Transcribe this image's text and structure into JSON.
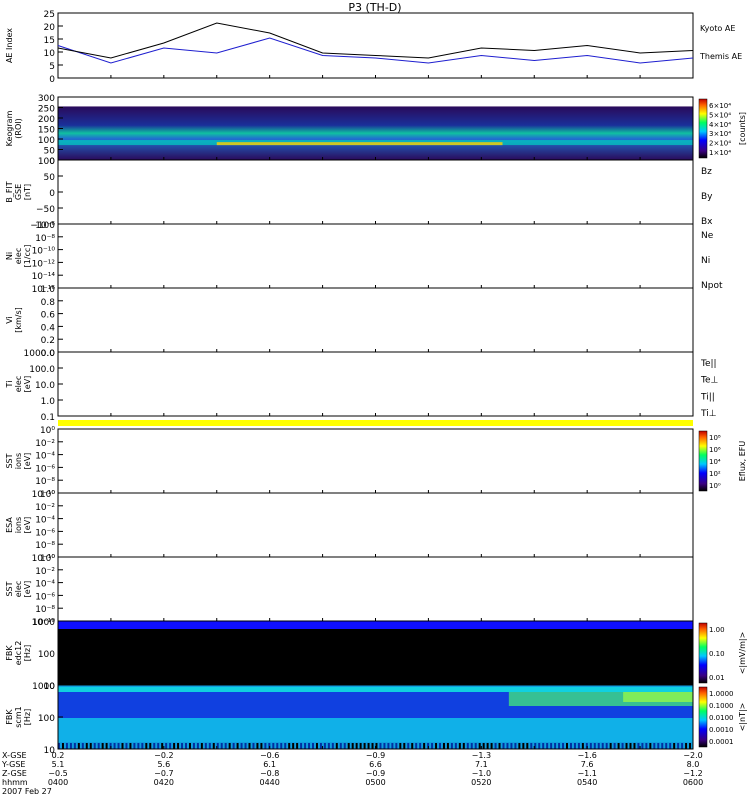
{
  "title": "P3 (TH-D)",
  "colors": {
    "black": "#000000",
    "blue": "#1e1ecf",
    "red": "#d00000",
    "green": "#00c000",
    "navy": "#0000a0",
    "yellow": "#ffff00",
    "fbk_blue": "#1010ff"
  },
  "chart_data": [
    {
      "panel": "ae",
      "type": "line",
      "ylabel": "AE Index",
      "yticks": [
        "25",
        "20",
        "15",
        "10",
        "5",
        "0"
      ],
      "ylim": [
        0,
        26
      ],
      "x": [
        "0400",
        "0410",
        "0420",
        "0430",
        "0440",
        "0450",
        "0500",
        "0510",
        "0520",
        "0530",
        "0540",
        "0550",
        "0600"
      ],
      "series": [
        {
          "name": "Kyoto AE",
          "color_key": "blue",
          "values": [
            13,
            6,
            12,
            10,
            16,
            9,
            8,
            6,
            9,
            7,
            9,
            6,
            8
          ]
        },
        {
          "name": "Themis AE",
          "color_key": "black",
          "values": [
            12,
            8,
            14,
            22,
            18,
            10,
            9,
            8,
            12,
            11,
            13,
            10,
            11
          ]
        }
      ]
    },
    {
      "panel": "keogram",
      "type": "heatmap",
      "ylabel": "Keogram",
      "ylabel2": "(ROI)",
      "yticks": [
        "300",
        "250",
        "200",
        "150",
        "100",
        "50",
        "0"
      ],
      "ylim": [
        0,
        300
      ],
      "colorbar_ticks": [
        "6×10⁴",
        "5×10⁴",
        "4×10⁴",
        "3×10⁴",
        "2×10⁴",
        "1×10⁴"
      ],
      "colorbar_label": "[counts]"
    },
    {
      "panel": "bfit",
      "type": "line",
      "ylabel": "B_FIT",
      "ylabel2": "GSE",
      "ylabel3": "[nT]",
      "yticks": [
        "100",
        "50",
        "0",
        "−50",
        "−100"
      ],
      "ylim": [
        -100,
        100
      ],
      "labels": [
        {
          "text": "Bz",
          "color_key": "red"
        },
        {
          "text": "By",
          "color_key": "green"
        },
        {
          "text": "Bx",
          "color_key": "navy"
        }
      ]
    },
    {
      "panel": "density",
      "type": "line",
      "ylabel": "Ni",
      "ylabel2": "elec",
      "ylabel3": "[1/cc]",
      "yticks": [
        "10⁻⁶",
        "10⁻⁸",
        "10⁻¹⁰",
        "10⁻¹²",
        "10⁻¹⁴",
        "10⁻¹⁶"
      ],
      "labels": [
        {
          "text": "Ne",
          "color_key": "red"
        },
        {
          "text": "Ni",
          "color_key": "black"
        },
        {
          "text": "Npot",
          "color_key": "navy"
        }
      ]
    },
    {
      "panel": "velocity",
      "type": "line",
      "ylabel": "Vi",
      "ylabel2": "[km/s]",
      "yticks": [
        "1.0",
        "0.8",
        "0.6",
        "0.4",
        "0.2",
        "0.0"
      ],
      "ylim": [
        0,
        1
      ]
    },
    {
      "panel": "temperature",
      "type": "line",
      "ylabel": "Ti",
      "ylabel2": "elec",
      "ylabel3": "[eV]",
      "yticks": [
        "1000.0",
        "100.0",
        "10.0",
        "1.0",
        "0.1"
      ],
      "labels": [
        {
          "text": "Te||",
          "color_key": "black"
        },
        {
          "text": "Te⊥",
          "color_key": "red"
        },
        {
          "text": "Ti||",
          "color_key": "green"
        },
        {
          "text": "Ti⊥",
          "color_key": "navy"
        }
      ]
    },
    {
      "panel": "sst_ion",
      "type": "heatmap",
      "ylabel": "SST",
      "ylabel2": "ions",
      "ylabel3": "[eV]",
      "yticks": [
        "10⁰",
        "10⁻²",
        "10⁻⁴",
        "10⁻⁶",
        "10⁻⁸",
        "10⁻¹⁰"
      ],
      "colorbar_ticks": [
        "10⁸",
        "10⁶",
        "10⁴",
        "10²",
        "10⁰"
      ],
      "colorbar_label": "Eflux, EFU"
    },
    {
      "panel": "esa",
      "type": "heatmap",
      "ylabel": "ESA",
      "ylabel2": "ions",
      "ylabel3": "[eV]",
      "yticks": [
        "10⁰",
        "10⁻²",
        "10⁻⁴",
        "10⁻⁶",
        "10⁻⁸",
        "10⁻¹⁰"
      ]
    },
    {
      "panel": "sst_elec",
      "type": "heatmap",
      "ylabel": "SST",
      "ylabel2": "elec",
      "ylabel3": "[eV]",
      "yticks": [
        "10⁰",
        "10⁻²",
        "10⁻⁴",
        "10⁻⁶",
        "10⁻⁸",
        "10⁻¹⁰"
      ]
    },
    {
      "panel": "fbk_e",
      "type": "heatmap",
      "ylabel": "FBK",
      "ylabel2": "edc12",
      "ylabel3": "[Hz]",
      "yticks": [
        "1000",
        "100",
        "10"
      ],
      "colorbar_ticks": [
        "1.00",
        "0.10",
        "0.01"
      ],
      "colorbar_label": "<|mV/m|>"
    },
    {
      "panel": "fbk_b",
      "type": "heatmap",
      "ylabel": "FBK",
      "ylabel2": "scm1",
      "ylabel3": "[Hz]",
      "yticks": [
        "1000",
        "100",
        "10"
      ],
      "colorbar_ticks": [
        "1.0000",
        "0.1000",
        "0.0100",
        "0.0010",
        "0.0001"
      ],
      "colorbar_label": "<|nT|>"
    }
  ],
  "xaxis": {
    "row_labels": [
      "X-GSE",
      "Y-GSE",
      "Z-GSE",
      "hhmm",
      "2007 Feb 27"
    ],
    "ticks": [
      {
        "x": "0.2",
        "y": "5.1",
        "z": "−0.5",
        "hhmm": "0400"
      },
      {
        "x": "−0.2",
        "y": "5.6",
        "z": "−0.7",
        "hhmm": "0420"
      },
      {
        "x": "−0.6",
        "y": "6.1",
        "z": "−0.8",
        "hhmm": "0440"
      },
      {
        "x": "−0.9",
        "y": "6.6",
        "z": "−0.9",
        "hhmm": "0500"
      },
      {
        "x": "−1.3",
        "y": "7.1",
        "z": "−1.0",
        "hhmm": "0520"
      },
      {
        "x": "−1.6",
        "y": "7.6",
        "z": "−1.1",
        "hhmm": "0540"
      },
      {
        "x": "−2.0",
        "y": "8.0",
        "z": "−1.2",
        "hhmm": "0600"
      }
    ]
  }
}
